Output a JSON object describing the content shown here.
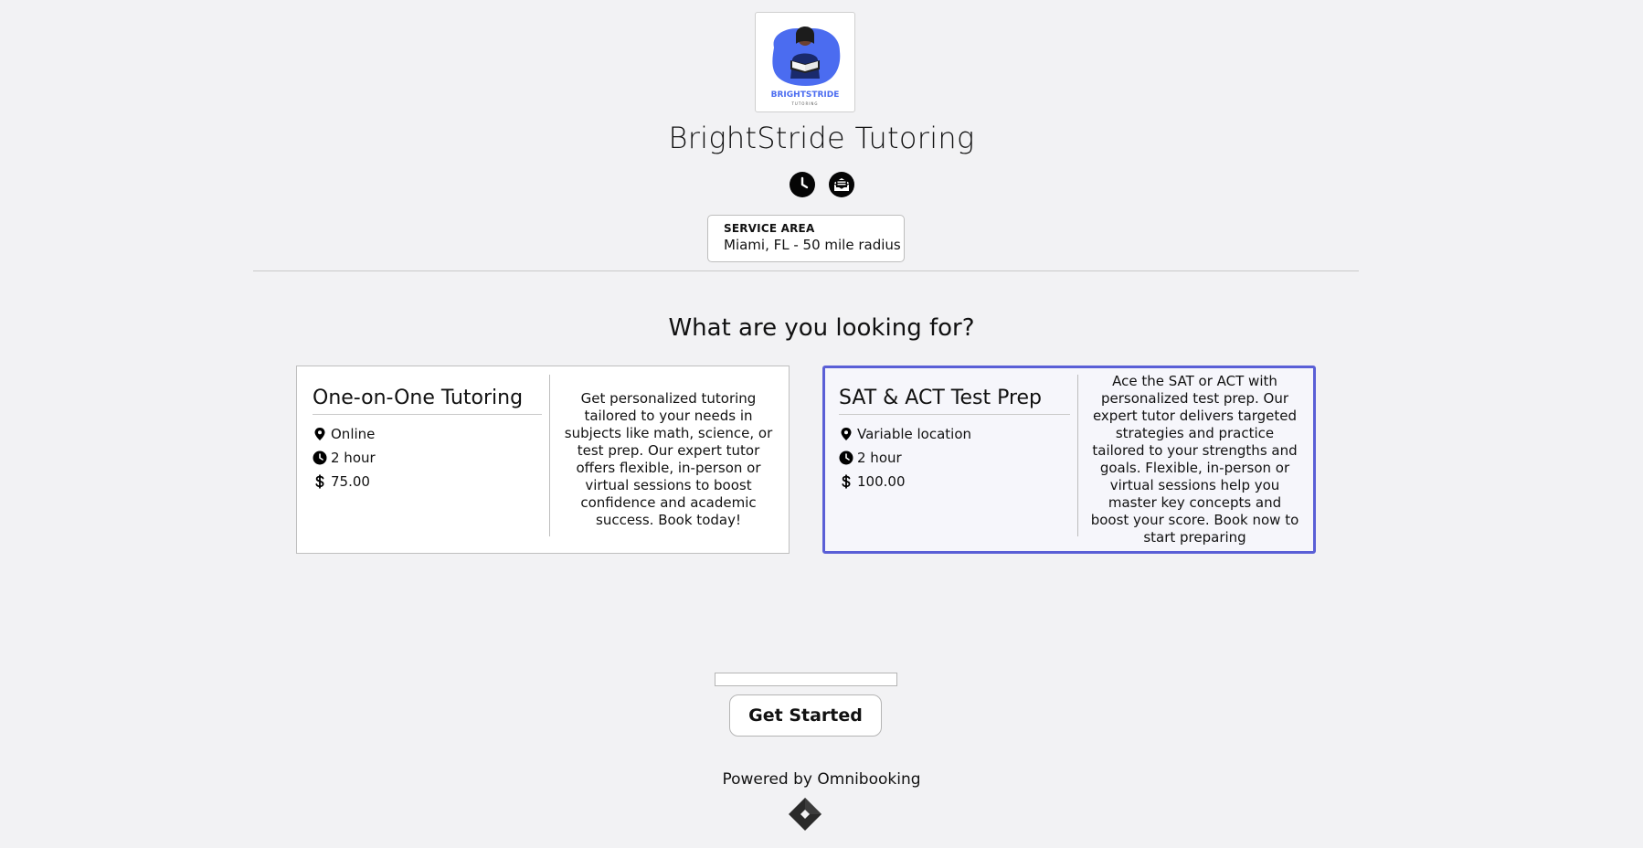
{
  "business": {
    "name": "BrightStride Tutoring",
    "logo_text": "BRIGHTSTRIDE",
    "logo_subtext": "TUTORING",
    "brand_color": "#4b6cf0"
  },
  "header_icons": [
    "clock-icon",
    "envelope-icon"
  ],
  "service_area": {
    "label": "SERVICE AREA",
    "value": "Miami, FL - 50 mile radius"
  },
  "section_heading": "What are you looking for?",
  "services": [
    {
      "title": "One-on-One Tutoring",
      "location": "Online",
      "duration": "2 hour",
      "price": "75.00",
      "description": "Get personalized tutoring tailored to your needs in subjects like math, science, or test prep. Our expert tutor offers flexible, in-person or virtual sessions to boost confidence and academic success. Book today!",
      "selected": false
    },
    {
      "title": "SAT & ACT Test Prep",
      "location": "Variable location",
      "duration": "2 hour",
      "price": "100.00",
      "description": "Ace the SAT or ACT with personalized test prep. Our expert tutor delivers targeted strategies and practice tailored to your strengths and goals. Flexible, in-person or virtual sessions help you master key concepts and boost your score. Book now to start preparing",
      "selected": true
    }
  ],
  "colors": {
    "selected_border": "#5a5fd6",
    "background": "#f2f2f4"
  },
  "cta": {
    "label": "Get Started"
  },
  "footer": {
    "powered_by": "Powered by Omnibooking"
  }
}
